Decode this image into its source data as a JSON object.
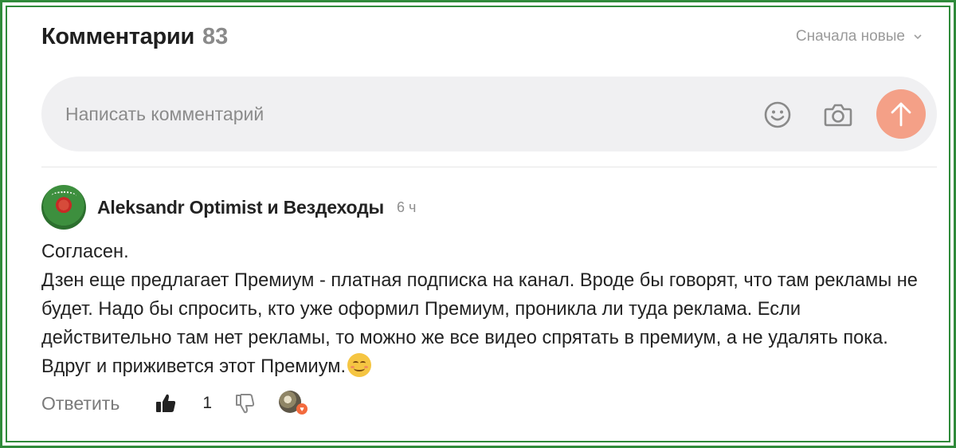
{
  "header": {
    "title": "Комментарии",
    "count": "83",
    "sort_label": "Сначала новые"
  },
  "composer": {
    "placeholder": "Написать комментарий"
  },
  "comment": {
    "author": "Aleksandr Optimist и Вездеходы",
    "time": "6 ч",
    "lines": [
      "Согласен.",
      "Дзен еще предлагает Премиум - платная подписка на канал. Вроде бы говорят, что там рекламы не будет. Надо бы спросить, кто уже оформил Премиум, проникла ли туда реклама. Если действительно там нет рекламы, то можно же все видео спрятать в премиум, а не удалять пока. Вдруг и приживется этот Премиум."
    ],
    "reply_label": "Ответить",
    "like_count": "1"
  },
  "icons": {
    "sort": "chevron-down-icon",
    "emoji": "smile-icon",
    "camera": "camera-icon",
    "send": "arrow-up-icon",
    "like": "thumbs-up-icon",
    "dislike": "thumbs-down-icon"
  },
  "colors": {
    "frame": "#2f8a3a",
    "send_button": "#f4a087",
    "composer_bg": "#f0f0f2"
  }
}
